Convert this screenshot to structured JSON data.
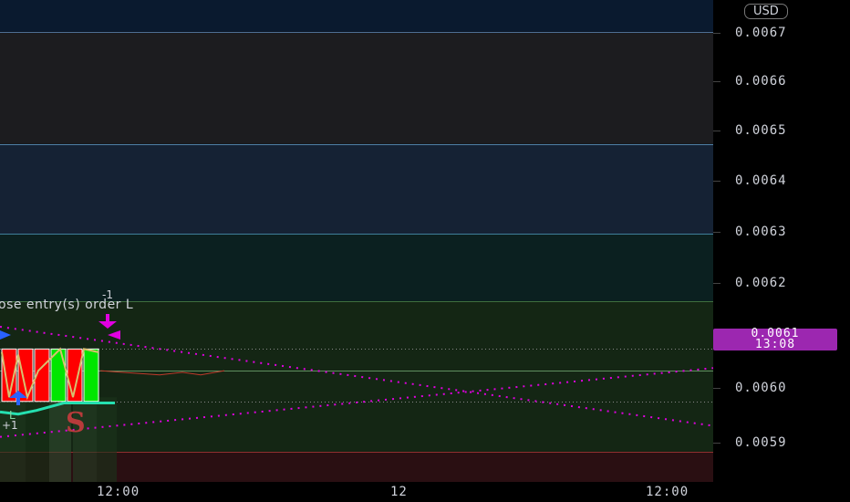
{
  "price_axis": {
    "currency": "USD",
    "ticks": [
      "0.0067",
      "0.0066",
      "0.0065",
      "0.0064",
      "0.0063",
      "0.0062",
      "0.0060",
      "0.0059"
    ],
    "last_price": "0.0061",
    "countdown": "13:08"
  },
  "time_axis": {
    "ticks": [
      "12:00",
      "12",
      "12:00"
    ]
  },
  "annotations": {
    "order_text": "ose entry(s) order L",
    "order_qty": "-1",
    "long_label": "L",
    "long_qty": "+1",
    "signal": "S"
  },
  "colors": {
    "up_candle": "#00e600",
    "down_candle": "#ff0000",
    "trend_line": "#e000e0",
    "last_price_bg": "#9c27b0"
  },
  "chart_data": {
    "type": "candlestick",
    "ylim": [
      0.00585,
      0.00676
    ],
    "y_ticks": [
      0.0067,
      0.0066,
      0.0065,
      0.0064,
      0.0063,
      0.0062,
      0.0061,
      0.006,
      0.0059
    ],
    "candles": [
      {
        "open": 0.006101,
        "close": 0.006002,
        "dir": "down"
      },
      {
        "open": 0.006101,
        "close": 0.006002,
        "dir": "down"
      },
      {
        "open": 0.006101,
        "close": 0.006002,
        "dir": "down"
      },
      {
        "open": 0.006002,
        "close": 0.006101,
        "dir": "up"
      },
      {
        "open": 0.006101,
        "close": 0.006002,
        "dir": "down"
      },
      {
        "open": 0.006002,
        "close": 0.006101,
        "dir": "up"
      }
    ],
    "bands": [
      {
        "from": 0.0067,
        "to": 0.00676,
        "color": "#0a1a2f"
      },
      {
        "from": 0.006488,
        "to": 0.0067,
        "color": "#1c1c1f"
      },
      {
        "from": 0.006318,
        "to": 0.006488,
        "color": "#152234"
      },
      {
        "from": 0.006191,
        "to": 0.006318,
        "color": "#0b2020"
      },
      {
        "from": 0.005907,
        "to": 0.006191,
        "color": "#142614"
      },
      {
        "from": 0.00585,
        "to": 0.005907,
        "color": "#2a0f12"
      }
    ],
    "level_lines": [
      {
        "value": 0.0067,
        "color": "#4e6f93"
      },
      {
        "value": 0.006488,
        "color": "#4e7fa5"
      },
      {
        "value": 0.006318,
        "color": "#3f7f9a"
      },
      {
        "value": 0.006191,
        "color": "#3e6f3e"
      },
      {
        "value": 0.00606,
        "color": "#5f8f5f"
      },
      {
        "value": 0.005907,
        "color": "#8f2f2f"
      }
    ],
    "dotted_levels": [
      0.006101,
      0.006002
    ]
  }
}
